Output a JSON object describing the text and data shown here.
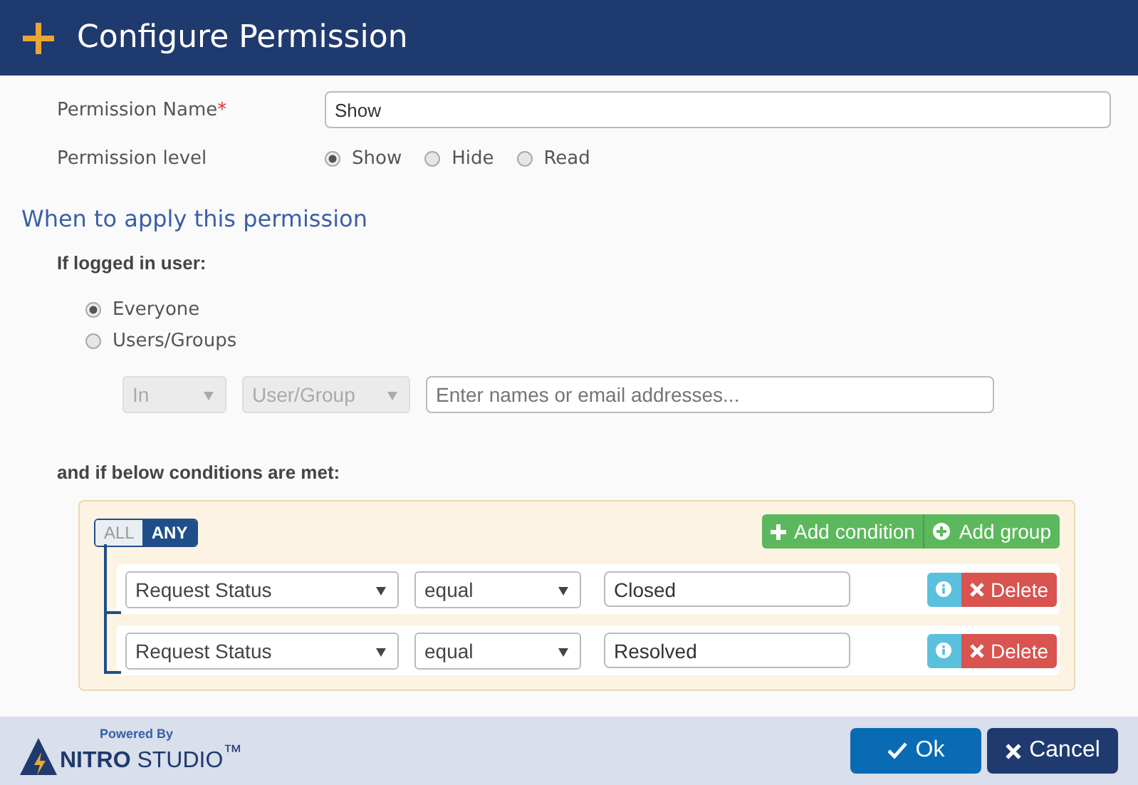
{
  "header": {
    "title": "Configure Permission"
  },
  "name_field": {
    "label": "Permission Name",
    "required_mark": "*",
    "value": "Show"
  },
  "permission_level": {
    "label": "Permission level",
    "options": [
      {
        "label": "Show",
        "selected": true
      },
      {
        "label": "Hide",
        "selected": false
      },
      {
        "label": "Read",
        "selected": false
      }
    ]
  },
  "section_title": "When to apply this permission",
  "logged_in": {
    "label": "If logged in user:",
    "options": [
      {
        "label": "Everyone",
        "selected": true
      },
      {
        "label": "Users/Groups",
        "selected": false
      }
    ]
  },
  "user_filter": {
    "disabled": true,
    "operator": "In",
    "type": "User/Group",
    "placeholder": "Enter names or email addresses..."
  },
  "conditions": {
    "label": "and if below conditions are met:",
    "toggle": [
      {
        "label": "ALL",
        "selected": false
      },
      {
        "label": "ANY",
        "selected": true
      }
    ],
    "add_condition": "Add condition",
    "add_group": "Add group",
    "rules": [
      {
        "field": "Request Status",
        "operator": "equal",
        "value": "Closed",
        "delete_label": "Delete"
      },
      {
        "field": "Request Status",
        "operator": "equal",
        "value": "Resolved",
        "delete_label": "Delete"
      }
    ]
  },
  "footer": {
    "powered_by": "Powered By",
    "brand": "**NITRO** STUDIO$^{™}$",
    "ok": "Ok",
    "cancel": "Cancel"
  }
}
